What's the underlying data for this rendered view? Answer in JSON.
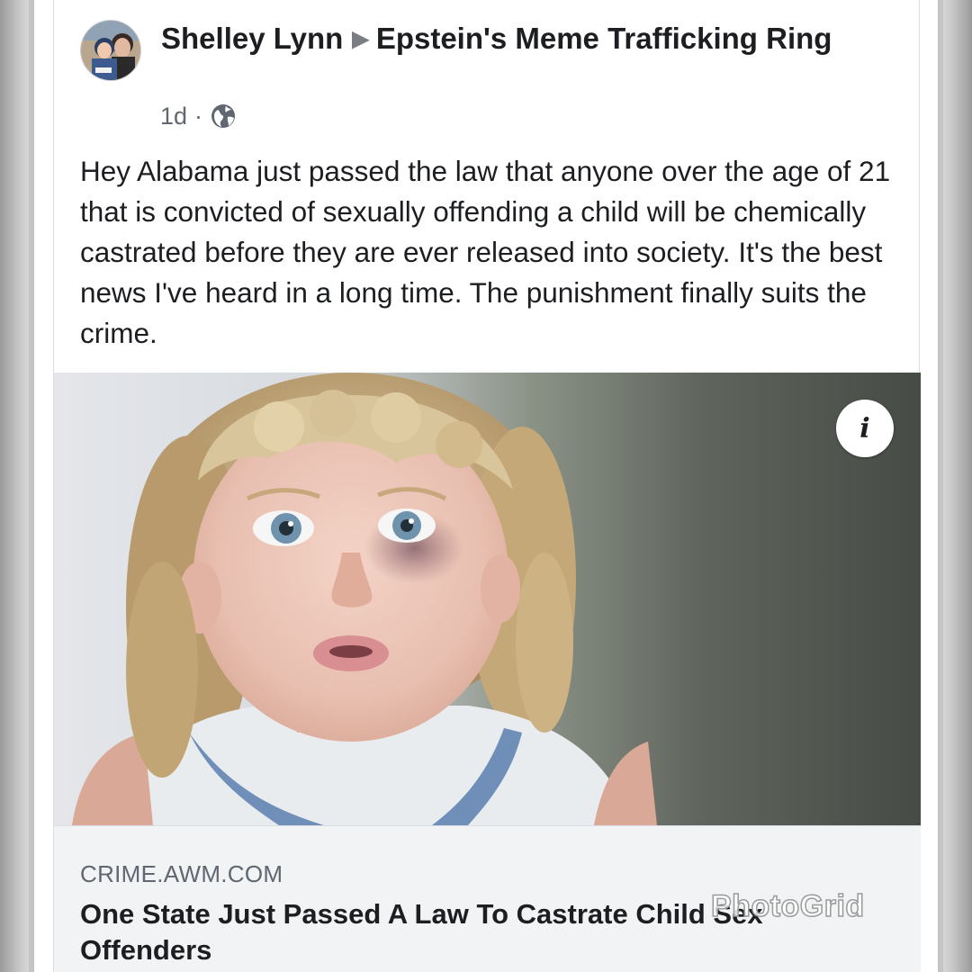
{
  "post": {
    "author": "Shelley Lynn",
    "group": "Epstein's Meme Trafficking Ring",
    "arrow_icon": "right-triangle-icon",
    "time": "1d",
    "separator": "·",
    "privacy_icon": "globe-icon",
    "text": "Hey Alabama just passed the law that anyone over the age of 21 that is convicted of sexually offending a child will be chemically castrated before they are ever released into society. It's the best news I've heard in a long time. The punishment finally suits the crime."
  },
  "link_preview": {
    "info_icon_label": "i",
    "domain": "CRIME.AWM.COM",
    "title": "One State Just Passed A Law To Castrate Child Sex Offenders"
  },
  "watermark": "PhotoGrid",
  "colors": {
    "text_primary": "#1c1e21",
    "text_secondary": "#606770",
    "link_box_bg": "#f2f3f5"
  }
}
